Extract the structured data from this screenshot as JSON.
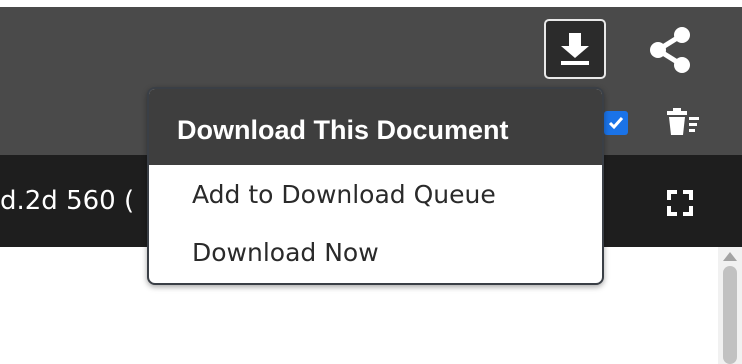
{
  "document": {
    "title_fragment": "d.2d 560 ("
  },
  "toolbar": {
    "download_icon": "download-icon",
    "share_icon": "share-icon",
    "checkbox_checked": true,
    "trash_icon": "trash-list-icon",
    "fullscreen_icon": "fullscreen-icon"
  },
  "download_menu": {
    "title": "Download This Document",
    "items": [
      {
        "label": "Add to Download Queue"
      },
      {
        "label": "Download Now"
      }
    ]
  },
  "colors": {
    "toolbar_bg": "#4a4a4a",
    "doc_bar_bg": "#1e1e1e",
    "menu_header_bg": "#3e3e3e",
    "checkbox_accent": "#1a73e8"
  }
}
